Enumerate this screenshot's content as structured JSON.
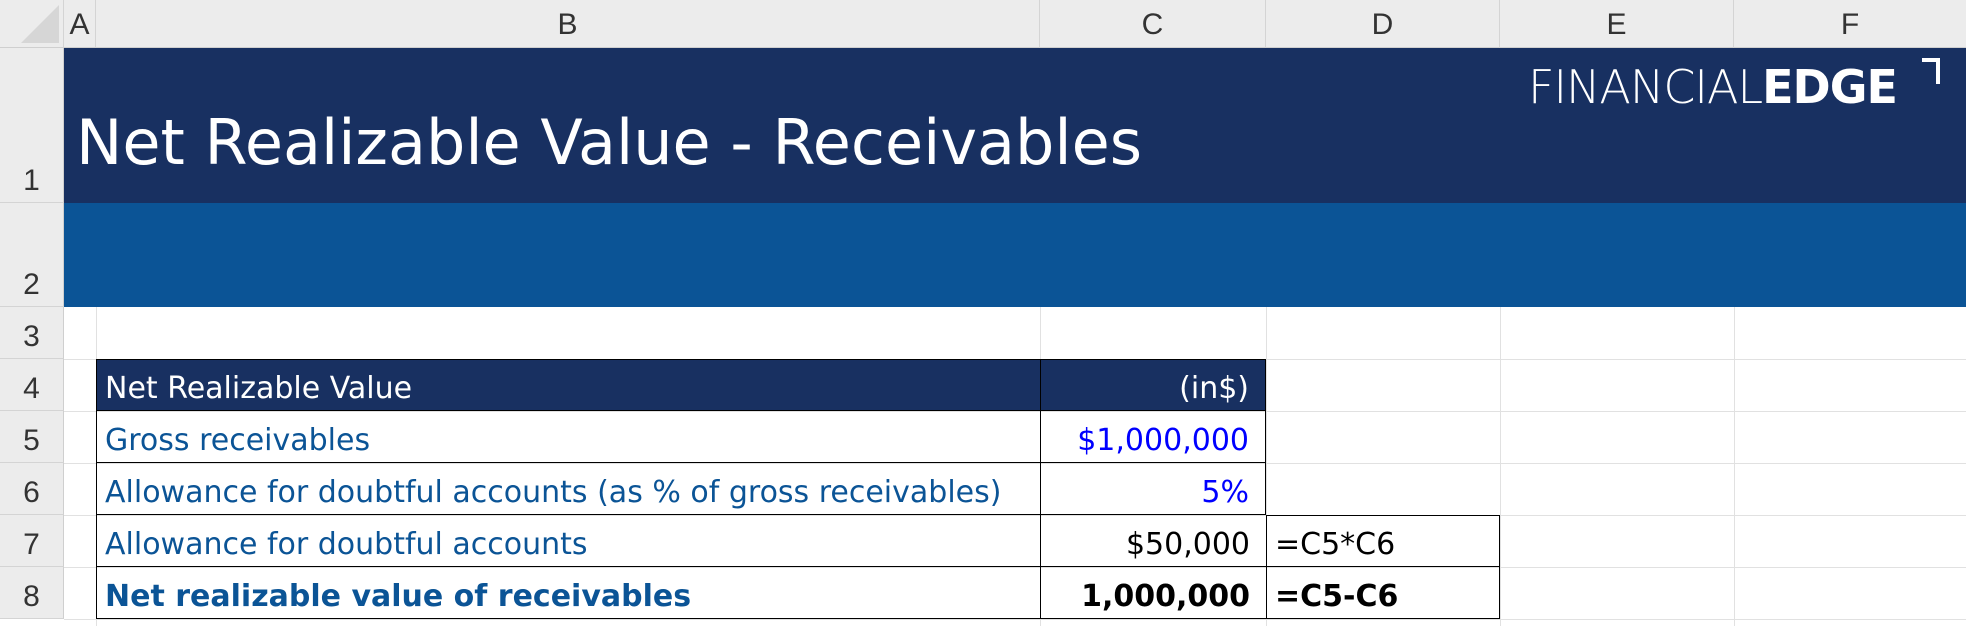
{
  "columns": [
    "A",
    "B",
    "C",
    "D",
    "E",
    "F"
  ],
  "rows": [
    "1",
    "2",
    "3",
    "4",
    "5",
    "6",
    "7",
    "8"
  ],
  "title": "Net Realizable Value - Receivables",
  "logo": {
    "light": "FINANCIAL",
    "bold": "EDGE"
  },
  "table": {
    "header_label": "Net Realizable Value",
    "header_unit": "(in$)",
    "rows": [
      {
        "label": "Gross receivables",
        "value": "$1,000,000",
        "formula": ""
      },
      {
        "label": "Allowance for doubtful accounts (as % of gross receivables)",
        "value": "5%",
        "formula": ""
      },
      {
        "label": "Allowance for doubtful accounts",
        "value": "$50,000",
        "formula": "=C5*C6"
      },
      {
        "label": "Net realizable value of receivables",
        "value": "1,000,000",
        "formula": "=C5-C6"
      }
    ]
  },
  "colors": {
    "title_band": "#183061",
    "sub_band": "#0b5496",
    "label_text": "#0b5496",
    "input_text": "#0000ff"
  }
}
